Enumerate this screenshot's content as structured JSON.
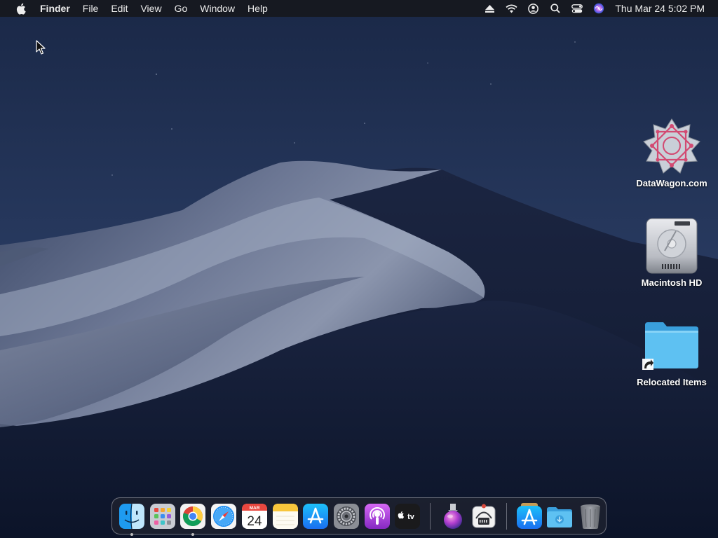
{
  "menubar": {
    "apple_icon": "apple-logo-icon",
    "app_name": "Finder",
    "menus": [
      "File",
      "Edit",
      "View",
      "Go",
      "Window",
      "Help"
    ],
    "status_icons": [
      "eject-icon",
      "wifi-icon",
      "user-icon",
      "search-icon",
      "control-center-icon",
      "siri-icon"
    ],
    "clock": "Thu Mar 24  5:02 PM"
  },
  "desktop": {
    "icons": [
      {
        "label": "DataWagon.com",
        "icon": "datawagon-logo-icon"
      },
      {
        "label": "Macintosh HD",
        "icon": "hard-drive-icon"
      },
      {
        "label": "Relocated Items",
        "icon": "folder-alias-icon"
      }
    ]
  },
  "dock": {
    "apps": [
      {
        "name": "Finder",
        "icon": "finder-icon",
        "running": true
      },
      {
        "name": "Launchpad",
        "icon": "launchpad-icon",
        "running": false
      },
      {
        "name": "Google Chrome",
        "icon": "chrome-icon",
        "running": true
      },
      {
        "name": "Safari",
        "icon": "safari-icon",
        "running": false
      },
      {
        "name": "Calendar",
        "icon": "calendar-icon",
        "running": false,
        "month": "MAR",
        "day": "24"
      },
      {
        "name": "Notes",
        "icon": "notes-icon",
        "running": false
      },
      {
        "name": "App Store",
        "icon": "app-store-icon",
        "running": false
      },
      {
        "name": "System Preferences",
        "icon": "system-preferences-icon",
        "running": false
      },
      {
        "name": "Podcasts",
        "icon": "podcasts-icon",
        "running": false
      },
      {
        "name": "TV",
        "icon": "apple-tv-icon",
        "running": false,
        "text": "tv"
      }
    ],
    "utilities": [
      {
        "name": "Installer",
        "icon": "installer-icon"
      },
      {
        "name": "Network Utility",
        "icon": "network-utility-icon"
      }
    ],
    "folders": [
      {
        "name": "Applications",
        "icon": "applications-stack-icon"
      },
      {
        "name": "Downloads",
        "icon": "downloads-folder-icon"
      },
      {
        "name": "Trash",
        "icon": "trash-icon"
      }
    ]
  },
  "colors": {
    "menubar_bg": "#16181e",
    "sky_top": "#1b2a4d",
    "sky_bottom": "#0f1830",
    "dune_light": "#9aa4b8",
    "folder_blue": "#48b5ec"
  }
}
